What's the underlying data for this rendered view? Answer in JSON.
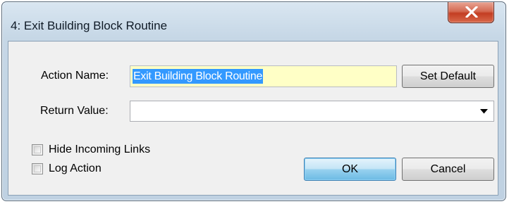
{
  "window": {
    "title": "4: Exit Building Block Routine"
  },
  "form": {
    "action_name_label": "Action Name:",
    "action_name_value": "Exit Building Block Routine",
    "return_value_label": "Return Value:",
    "return_value_value": "",
    "hide_incoming_links_label": "Hide Incoming Links",
    "hide_incoming_links_checked": false,
    "log_action_label": "Log Action",
    "log_action_checked": false
  },
  "buttons": {
    "set_default": "Set Default",
    "ok": "OK",
    "cancel": "Cancel"
  },
  "icons": {
    "close": "close-icon",
    "dropdown": "dropdown-arrow-icon"
  },
  "colors": {
    "action_name_field_bg": "#ffffc6",
    "selection": "#3399ff",
    "close_button": "#c33d22"
  }
}
